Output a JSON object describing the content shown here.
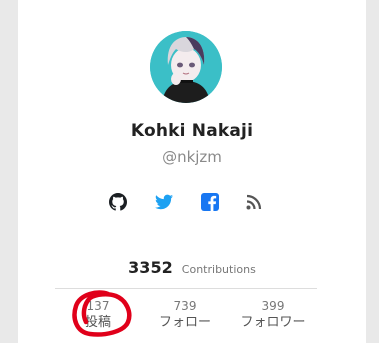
{
  "profile": {
    "name": "Kohki Nakaji",
    "handle": "@nkjzm"
  },
  "social_links": [
    {
      "icon": "github-icon"
    },
    {
      "icon": "twitter-icon"
    },
    {
      "icon": "facebook-icon"
    },
    {
      "icon": "rss-icon"
    }
  ],
  "contributions": {
    "count": "3352",
    "label": "Contributions"
  },
  "stats": [
    {
      "value": "137",
      "label": "投稿"
    },
    {
      "value": "739",
      "label": "フォロー"
    },
    {
      "value": "399",
      "label": "フォロワー"
    }
  ],
  "colors": {
    "twitter": "#1da1f2",
    "facebook": "#1877f2",
    "annotation": "#e0001a",
    "avatar_bg": "#3bbfc7"
  }
}
